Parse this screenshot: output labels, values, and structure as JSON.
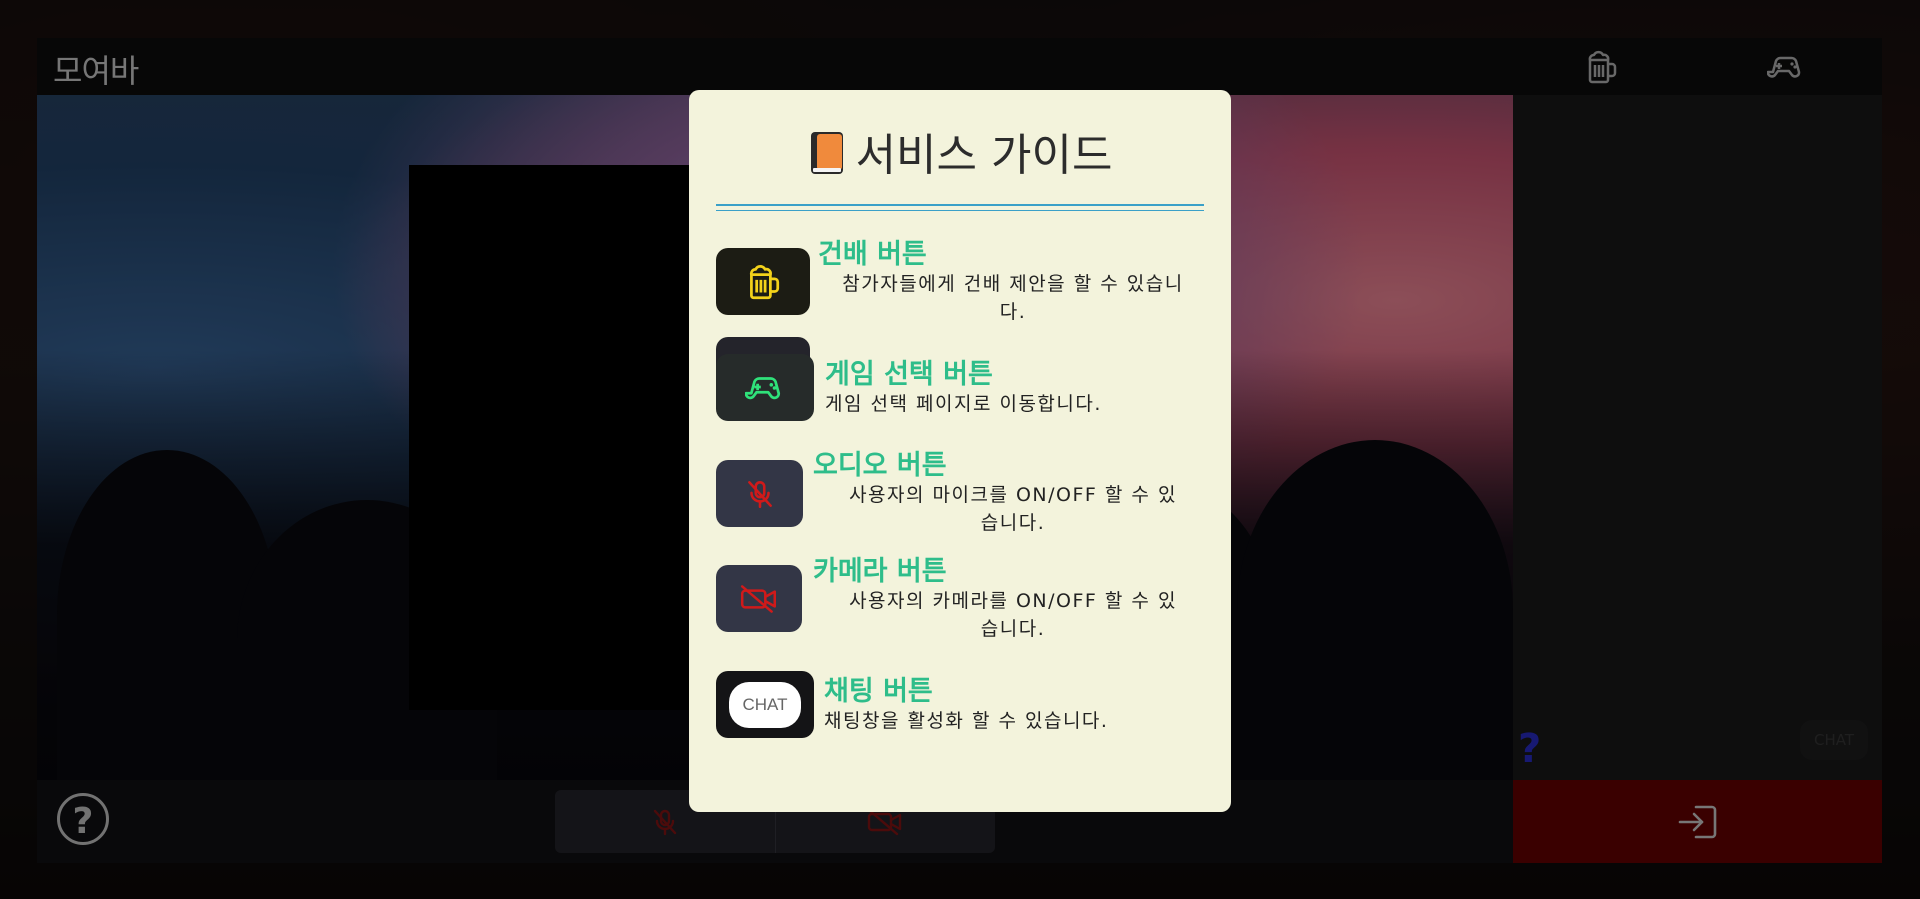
{
  "app": {
    "name": "모여바"
  },
  "modal": {
    "title": "서비스 가이드",
    "items": [
      {
        "icon": "beer-mug-icon",
        "title": "건배 버튼",
        "desc_line1": "참가자들에게 건배 제안을 할 수 있습니",
        "desc_line2": "다."
      },
      {
        "icon": "gamepad-icon",
        "title": "게임 선택 버튼",
        "desc_line1": "게임 선택 페이지로 이동합니다.",
        "desc_line2": ""
      },
      {
        "icon": "mic-off-icon",
        "title": "오디오 버튼",
        "desc_line1": "사용자의 마이크를 ON/OFF 할 수 있",
        "desc_line2": "습니다."
      },
      {
        "icon": "camera-off-icon",
        "title": "카메라 버튼",
        "desc_line1": "사용자의 카메라를 ON/OFF 할 수 있",
        "desc_line2": "습니다."
      },
      {
        "icon": "chat-bubble-icon",
        "title": "채팅 버튼",
        "desc_line1": "채팅창을 활성화 할 수 있습니다.",
        "desc_line2": "",
        "badge": "CHAT"
      }
    ]
  },
  "side": {
    "help_mark": "?",
    "chat_label": "CHAT"
  },
  "bottom": {
    "help_label": "?"
  },
  "colors": {
    "accent_green": "#2ebd8a",
    "modal_bg": "#f3f3dc",
    "exit_bg": "#6b0000",
    "mic_off_red": "#d01a1a",
    "neon_yellow": "#f3d21a",
    "neon_green": "#2fe27a"
  }
}
